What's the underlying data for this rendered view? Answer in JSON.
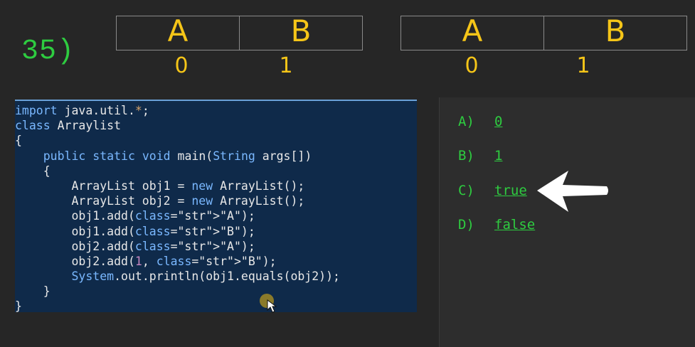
{
  "question_number": "35)",
  "diagram": {
    "left_box": {
      "cells": [
        "A",
        "B"
      ],
      "indices": [
        "0",
        "1"
      ]
    },
    "right_box": {
      "cells": [
        "A",
        "B"
      ],
      "indices": [
        "0",
        "1"
      ]
    }
  },
  "code_lines": [
    "import java.util.*;",
    "class Arraylist",
    "{",
    "    public static void main(String args[])",
    "    {",
    "        ArrayList obj1 = new ArrayList();",
    "        ArrayList obj2 = new ArrayList();",
    "        obj1.add(\"A\");",
    "        obj1.add(\"B\");",
    "        obj2.add(\"A\");",
    "        obj2.add(1, \"B\");",
    "        System.out.println(obj1.equals(obj2));",
    "    }",
    "}"
  ],
  "options": [
    {
      "label": "A)",
      "value": "0"
    },
    {
      "label": "B)",
      "value": "1"
    },
    {
      "label": "C)",
      "value": "true"
    },
    {
      "label": "D)",
      "value": "false"
    }
  ],
  "colors": {
    "accent_green": "#2ecc40",
    "handwriting_yellow": "#f5c518",
    "code_bg": "#0f2a4a"
  },
  "icons": [
    "white-arrow-icon",
    "mouse-cursor-icon"
  ]
}
